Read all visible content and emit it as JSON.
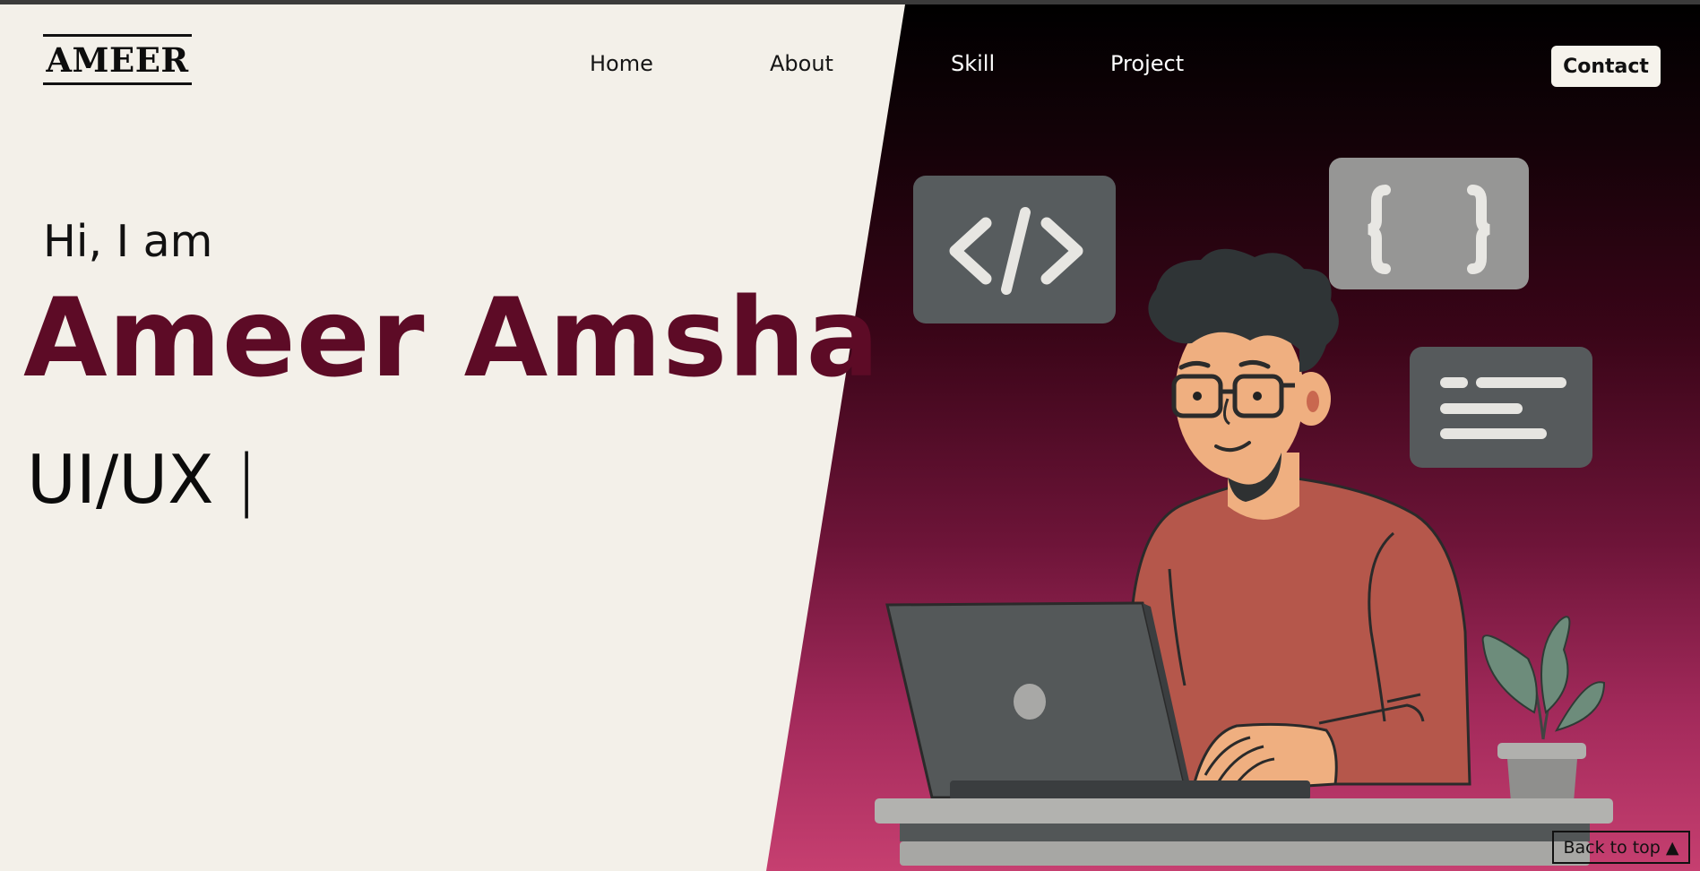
{
  "nav": {
    "logo": "AMEER",
    "links": [
      "Home",
      "About",
      "Skill",
      "Project"
    ],
    "contact_label": "Contact"
  },
  "hero": {
    "greeting": "Hi, I am",
    "name": "Ameer Amsha",
    "role": "UI/UX",
    "caret": "|"
  },
  "back_to_top": "Back to top ▲",
  "colors": {
    "background": "#f3f0e9",
    "name_accent": "#5d0b26",
    "gradient_top": "#000000",
    "gradient_bottom": "#c63f70"
  }
}
